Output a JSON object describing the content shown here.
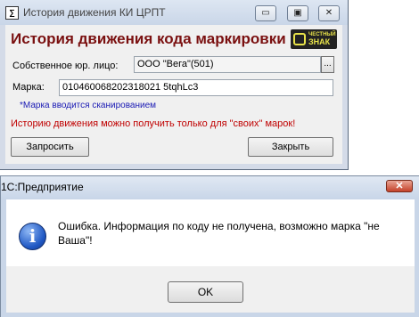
{
  "back_window": {
    "app_icon": "1c-app-icon",
    "title": "История движения КИ ЦРПТ",
    "controls": {
      "minimize": "▭",
      "maximize": "▣",
      "close": "✕"
    },
    "heading": "История движения кода маркировки",
    "logo_text_line1": "ЧЕСТНЫЙ",
    "logo_text_line2": "ЗНАК",
    "legal_entity_label": "Собственное юр. лицо:",
    "legal_entity_value": "ООО \"Вега\"(501)",
    "select_button": "...",
    "mark_label": "Марка:",
    "mark_value": "010460068202318021 5tqhLc3",
    "hint": "*Марка вводится сканированием",
    "warning": "Историю движения можно получить только для \"своих\" марок!",
    "request_button": "Запросить",
    "close_button": "Закрыть"
  },
  "dialog": {
    "title": "1С:Предприятие",
    "close_button": "✕",
    "icon": "info-icon",
    "message": "Ошибка. Информация по коду не получена, возможно марка \"не Ваша\"!",
    "ok_button": "OK"
  }
}
